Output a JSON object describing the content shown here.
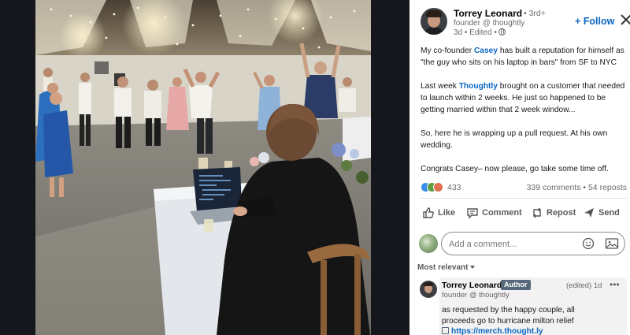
{
  "post": {
    "author": {
      "name": "Torrey Leonard",
      "degree": "• 3rd+",
      "headline": "founder @ thoughtly",
      "meta": "3d • Edited •"
    },
    "follow_label": "+ Follow",
    "body": {
      "p1": {
        "before": "My co-founder ",
        "mention": "Casey",
        "after": " has built a reputation for himself as \"the guy who sits on his laptop in bars\" from SF to NYC"
      },
      "p2": {
        "before": "Last week ",
        "mention": "Thoughtly",
        "after": " brought on a customer that needed to launch within 2 weeks. He just so happened to be getting married within that 2 week window..."
      },
      "p3": "So, here he is wrapping up a pull request. At his own wedding.",
      "p4": "Congrats Casey– now please, go take some time off."
    },
    "social": {
      "reactions_count": "433",
      "comments_reposts": "339 comments • 54 reposts",
      "reaction_colors": [
        "#378fe9",
        "#5f9b41",
        "#df704d"
      ]
    },
    "actions": {
      "like": "Like",
      "comment": "Comment",
      "repost": "Repost",
      "send": "Send"
    }
  },
  "composer": {
    "placeholder": "Add a comment..."
  },
  "sort": {
    "label": "Most relevant"
  },
  "comments": [
    {
      "name": "Torrey Leonard",
      "badge": "Author",
      "time": "(edited) 1d",
      "more": "•••",
      "headline": "founder @ thoughtly",
      "text": "as requested by the happy couple, all proceeds go to hurricane milton relief",
      "link": "https://merch.thought.ly"
    }
  ],
  "colors": {
    "accent": "#0a66c2",
    "author_badge": "#56687a"
  },
  "icons": [
    "close-icon",
    "globe-icon",
    "like-icon",
    "comment-icon",
    "repost-icon",
    "send-icon",
    "emoji-icon",
    "image-icon",
    "chevron-down-icon",
    "link-icon"
  ]
}
